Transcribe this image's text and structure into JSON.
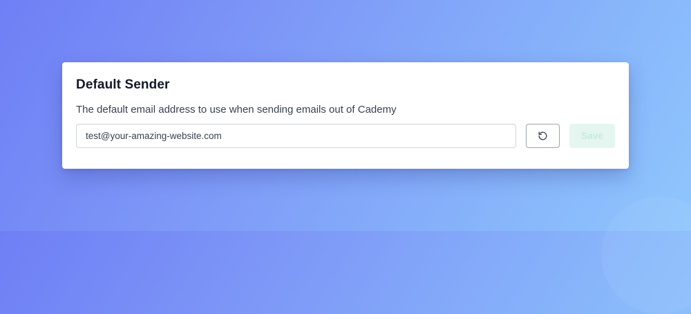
{
  "card": {
    "title": "Default Sender",
    "description": "The default email address to use when sending emails out of Cademy",
    "email_value": "test@your-amazing-website.com",
    "reset_icon": "reset-icon",
    "save_label": "Save",
    "save_disabled": true
  },
  "colors": {
    "save_bg": "#e4f6ef",
    "save_text": "#c7ebdd",
    "title": "#111827"
  }
}
